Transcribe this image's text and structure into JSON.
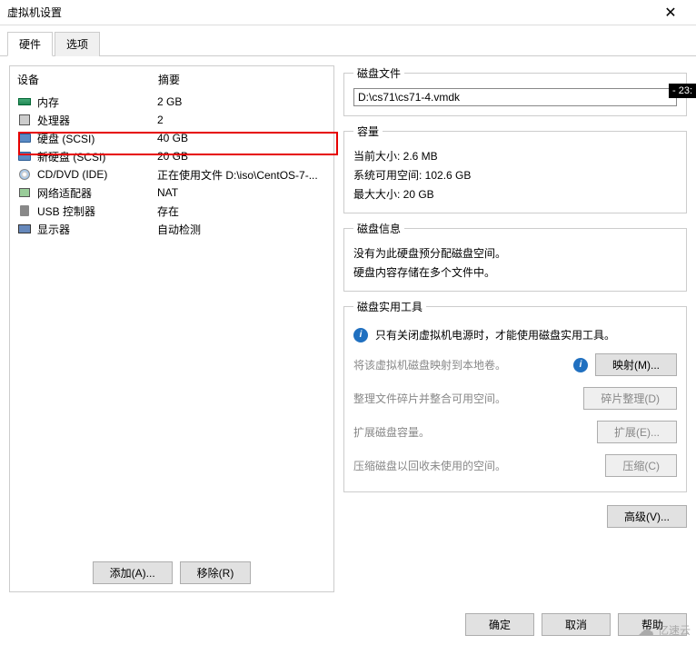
{
  "window": {
    "title": "虚拟机设置",
    "close": "✕"
  },
  "tabs": {
    "hardware": "硬件",
    "options": "选项"
  },
  "headers": {
    "device": "设备",
    "summary": "摘要"
  },
  "devices": [
    {
      "icon": "mem",
      "name": "内存",
      "summary": "2 GB"
    },
    {
      "icon": "cpu",
      "name": "处理器",
      "summary": "2"
    },
    {
      "icon": "disk",
      "name": "硬盘 (SCSI)",
      "summary": "40 GB"
    },
    {
      "icon": "disk",
      "name": "新硬盘 (SCSI)",
      "summary": "20 GB"
    },
    {
      "icon": "cd",
      "name": "CD/DVD (IDE)",
      "summary": "正在使用文件 D:\\iso\\CentOS-7-..."
    },
    {
      "icon": "net",
      "name": "网络适配器",
      "summary": "NAT"
    },
    {
      "icon": "usb",
      "name": "USB 控制器",
      "summary": "存在"
    },
    {
      "icon": "mon",
      "name": "显示器",
      "summary": "自动检测"
    }
  ],
  "buttons": {
    "add": "添加(A)...",
    "remove": "移除(R)"
  },
  "diskfile": {
    "legend": "磁盘文件",
    "path": "D:\\cs71\\cs71-4.vmdk"
  },
  "capacity": {
    "legend": "容量",
    "current": "当前大小: 2.6 MB",
    "free": "系统可用空间: 102.6 GB",
    "max": "最大大小: 20 GB"
  },
  "diskinfo": {
    "legend": "磁盘信息",
    "line1": "没有为此硬盘预分配磁盘空间。",
    "line2": "硬盘内容存储在多个文件中。"
  },
  "tools": {
    "legend": "磁盘实用工具",
    "warn": "只有关闭虚拟机电源时，才能使用磁盘实用工具。",
    "map_desc": "将该虚拟机磁盘映射到本地卷。",
    "map_btn": "映射(M)...",
    "defrag_desc": "整理文件碎片并整合可用空间。",
    "defrag_btn": "碎片整理(D)",
    "expand_desc": "扩展磁盘容量。",
    "expand_btn": "扩展(E)...",
    "compact_desc": "压缩磁盘以回收未使用的空间。",
    "compact_btn": "压缩(C)"
  },
  "advanced": "高级(V)...",
  "dialog": {
    "ok": "确定",
    "cancel": "取消",
    "help": "帮助"
  },
  "time": "- 23:",
  "watermark": "亿速云"
}
